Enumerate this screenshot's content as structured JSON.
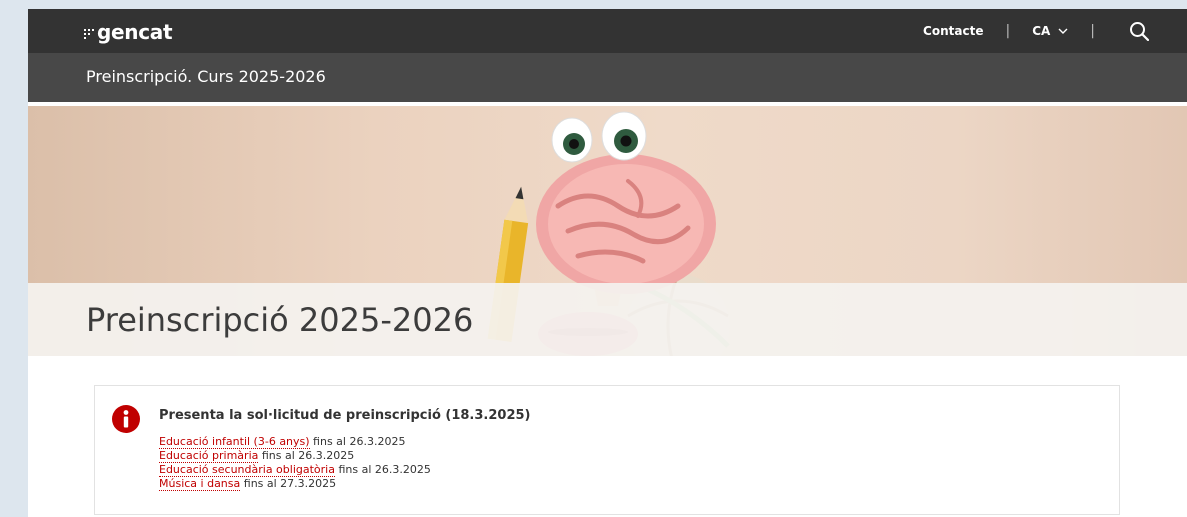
{
  "header": {
    "logo_text": "gencat",
    "contact_label": "Contacte",
    "language_label": "CA",
    "separator": "|"
  },
  "subheader": {
    "title": "Preinscripció. Curs 2025-2026"
  },
  "hero": {
    "title": "Preinscripció 2025-2026"
  },
  "notice": {
    "title": "Presenta la sol·licitud de preinscripció (18.3.2025)",
    "items": [
      {
        "link": "Educació infantil (3-6 anys)",
        "suffix": " fins al 26.3.2025"
      },
      {
        "link": "Educació primària",
        "suffix": " fins al 26.3.2025"
      },
      {
        "link": "Educació secundària obligatòria",
        "suffix": " fins al 26.3.2025"
      },
      {
        "link": "Música i dansa",
        "suffix": " fins al 27.3.2025"
      }
    ]
  },
  "colors": {
    "topbar": "#333333",
    "subbar": "#484848",
    "link": "#c00000",
    "alert_icon": "#c00000"
  },
  "icons": {
    "logo_mark": "gencat-logo-icon",
    "language_dropdown": "chevron-down-icon",
    "search": "search-icon",
    "alert": "info-icon"
  }
}
